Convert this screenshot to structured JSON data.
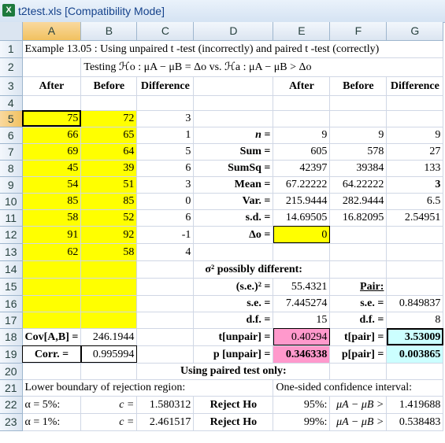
{
  "window": {
    "title": "t2test.xls  [Compatibility Mode]",
    "icon": "excel-icon"
  },
  "columns": [
    "A",
    "B",
    "C",
    "D",
    "E",
    "F",
    "G"
  ],
  "rows": [
    "1",
    "2",
    "3",
    "4",
    "5",
    "6",
    "7",
    "8",
    "9",
    "10",
    "11",
    "12",
    "13",
    "14",
    "15",
    "16",
    "17",
    "18",
    "19",
    "20",
    "21",
    "22",
    "23"
  ],
  "r1": {
    "text": "Example 13.05 :  Using unpaired t -test (incorrectly) and paired t -test (correctly)"
  },
  "r2": {
    "text": "Testing  ℋo : μA − μB = Δo  vs.  ℋa : μA − μB > Δo"
  },
  "r3": {
    "a": "After",
    "b": "Before",
    "c": "Difference",
    "e": "After",
    "f": "Before",
    "g": "Difference"
  },
  "data": {
    "after": [
      "75",
      "66",
      "69",
      "45",
      "54",
      "85",
      "58",
      "91",
      "62"
    ],
    "before": [
      "72",
      "65",
      "64",
      "39",
      "51",
      "85",
      "52",
      "92",
      "58"
    ],
    "diff": [
      "3",
      "1",
      "5",
      "6",
      "3",
      "0",
      "6",
      "-1",
      "4"
    ]
  },
  "stats": {
    "n": {
      "label": "n =",
      "e": "9",
      "f": "9",
      "g": "9"
    },
    "sum": {
      "label": "Sum =",
      "e": "605",
      "f": "578",
      "g": "27"
    },
    "sumsq": {
      "label": "SumSq =",
      "e": "42397",
      "f": "39384",
      "g": "133"
    },
    "mean": {
      "label": "Mean =",
      "e": "67.22222",
      "f": "64.22222",
      "g": "3"
    },
    "var": {
      "label": "Var. =",
      "e": "215.9444",
      "f": "282.9444",
      "g": "6.5"
    },
    "sd": {
      "label": "s.d. =",
      "e": "14.69505",
      "f": "16.82095",
      "g": "2.54951"
    },
    "delta": {
      "label": "Δo =",
      "e": "0"
    }
  },
  "r14": {
    "text": "σ² possibly different:"
  },
  "r15": {
    "label": "(s.e.)² =",
    "e": "55.4321",
    "pair": "Pair:"
  },
  "r16": {
    "label": "s.e. =",
    "e": "7.445274",
    "f_label": "s.e. =",
    "g": "0.849837"
  },
  "r17": {
    "label": "d.f. =",
    "e": "15",
    "f_label": "d.f. =",
    "g": "8"
  },
  "r18": {
    "a": "Cov[A,B] =",
    "b": "246.1944",
    "label": "t[unpair] =",
    "e": "0.40294",
    "f_label": "t[pair] =",
    "g": "3.53009"
  },
  "r19": {
    "a": "Corr. =",
    "b": "0.995994",
    "label": "p [unpair] =",
    "e": "0.346338",
    "f_label": "p[pair] =",
    "g": "0.003865"
  },
  "r20": {
    "text": "Using paired test only:"
  },
  "r21": {
    "left": "Lower boundary of rejection region:",
    "right": "One-sided confidence interval:"
  },
  "r22": {
    "a": "α = 5%:",
    "b": "c =",
    "c": "1.580312",
    "d": "Reject Ho",
    "e": "95%:",
    "f": "μA − μB >",
    "g": "1.419688"
  },
  "r23": {
    "a": "α = 1%:",
    "b": "c =",
    "c": "2.461517",
    "d": "Reject Ho",
    "e": "99%:",
    "f": "μA − μB >",
    "g": "0.538483"
  }
}
